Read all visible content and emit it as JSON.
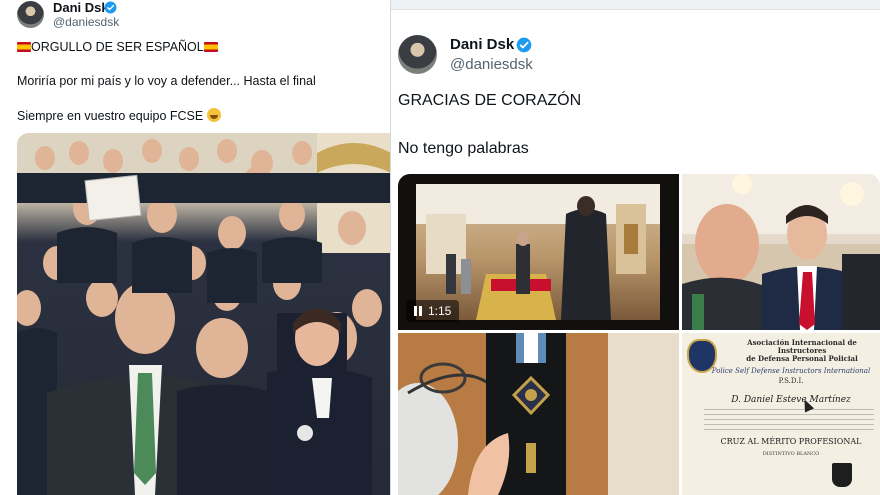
{
  "left_post": {
    "author_name": "Dani Dsk",
    "author_handle": "@daniesdsk",
    "line1": "ORGULLO DE SER ESPAÑOL",
    "line2": "Moriría por mi país y lo voy a defender... Hasta el final",
    "line3": "Siempre en vuestro equipo FCSE",
    "icons": [
      "spain-flag-icon",
      "verified-icon",
      "smiling-face-icon"
    ]
  },
  "right_post": {
    "author_name": "Dani Dsk",
    "author_handle": "@daniesdsk",
    "text1": "GRACIAS DE CORAZÓN",
    "text2": "No tengo palabras",
    "video": {
      "duration": "1:15",
      "state": "paused"
    },
    "certificate": {
      "title_line1": "Asociación Internacional de Instructores",
      "title_line2": "de Defensa Personal Policial",
      "subtitle": "Police Self Defense Instructors International",
      "code": "P.S.D.I.",
      "recipient": "D. Daniel Esteve Martínez",
      "award": "CRUZ AL MÉRITO PROFESIONAL",
      "distinctive": "DISTINTIVO BLANCO"
    }
  },
  "colors": {
    "verified_blue": "#1d9bf0",
    "text_primary": "#0f1419",
    "text_secondary": "#536471",
    "divider": "#cfd9de"
  }
}
